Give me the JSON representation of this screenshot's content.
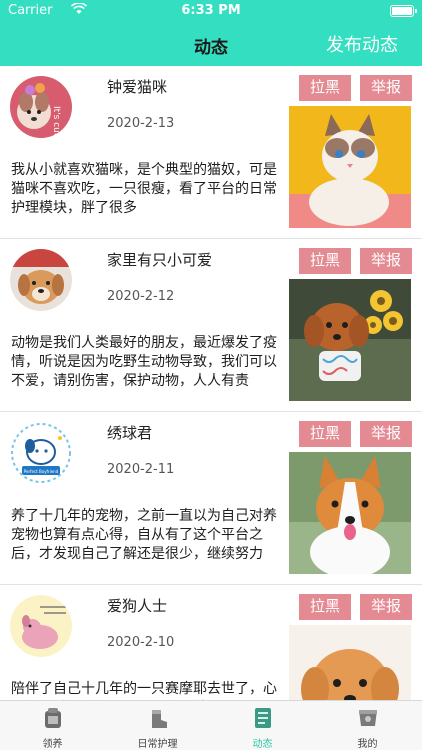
{
  "status_bar": {
    "carrier": "Carrier",
    "time": "6:33 PM"
  },
  "nav": {
    "title": "动态",
    "right_action": "发布动态"
  },
  "posts": [
    {
      "username": "钟爱猫咪",
      "date": "2020-2-13",
      "content": "我从小就喜欢猫咪，是个典型的猫奴，可是猫咪不喜欢吃，一只很瘦，看了平台的日常护理模块，胖了很多",
      "block_label": "拉黑",
      "report_label": "举报",
      "avatar_badge": "It's cute"
    },
    {
      "username": "家里有只小可爱",
      "date": "2020-2-12",
      "content": "动物是我们人类最好的朋友，最近爆发了疫情，听说是因为吃野生动物导致，我们可以不爱，请别伤害，保护动物，人人有责",
      "block_label": "拉黑",
      "report_label": "举报"
    },
    {
      "username": "绣球君",
      "date": "2020-2-11",
      "content": "养了十几年的宠物，之前一直以为自己对养宠物也算有点心得，自从有了这个平台之后，才发现自己了解还是很少，继续努力",
      "block_label": "拉黑",
      "report_label": "举报",
      "avatar_badge": "Perfect Boyfriend"
    },
    {
      "username": "爱狗人士",
      "date": "2020-2-10",
      "content": "陪伴了自己十几年的一只赛摩耶去世了，心里很难过，感觉以后都不会再养了",
      "block_label": "拉黑",
      "report_label": "举报"
    }
  ],
  "tabs": [
    {
      "label": "领养",
      "icon": "adopt-icon",
      "active": false
    },
    {
      "label": "日常护理",
      "icon": "care-icon",
      "active": false
    },
    {
      "label": "动态",
      "icon": "feed-icon",
      "active": true
    },
    {
      "label": "我的",
      "icon": "profile-icon",
      "active": false
    }
  ],
  "colors": {
    "accent": "#33dfc0",
    "button": "#e48a92",
    "active_tab": "#2cc4a6"
  }
}
